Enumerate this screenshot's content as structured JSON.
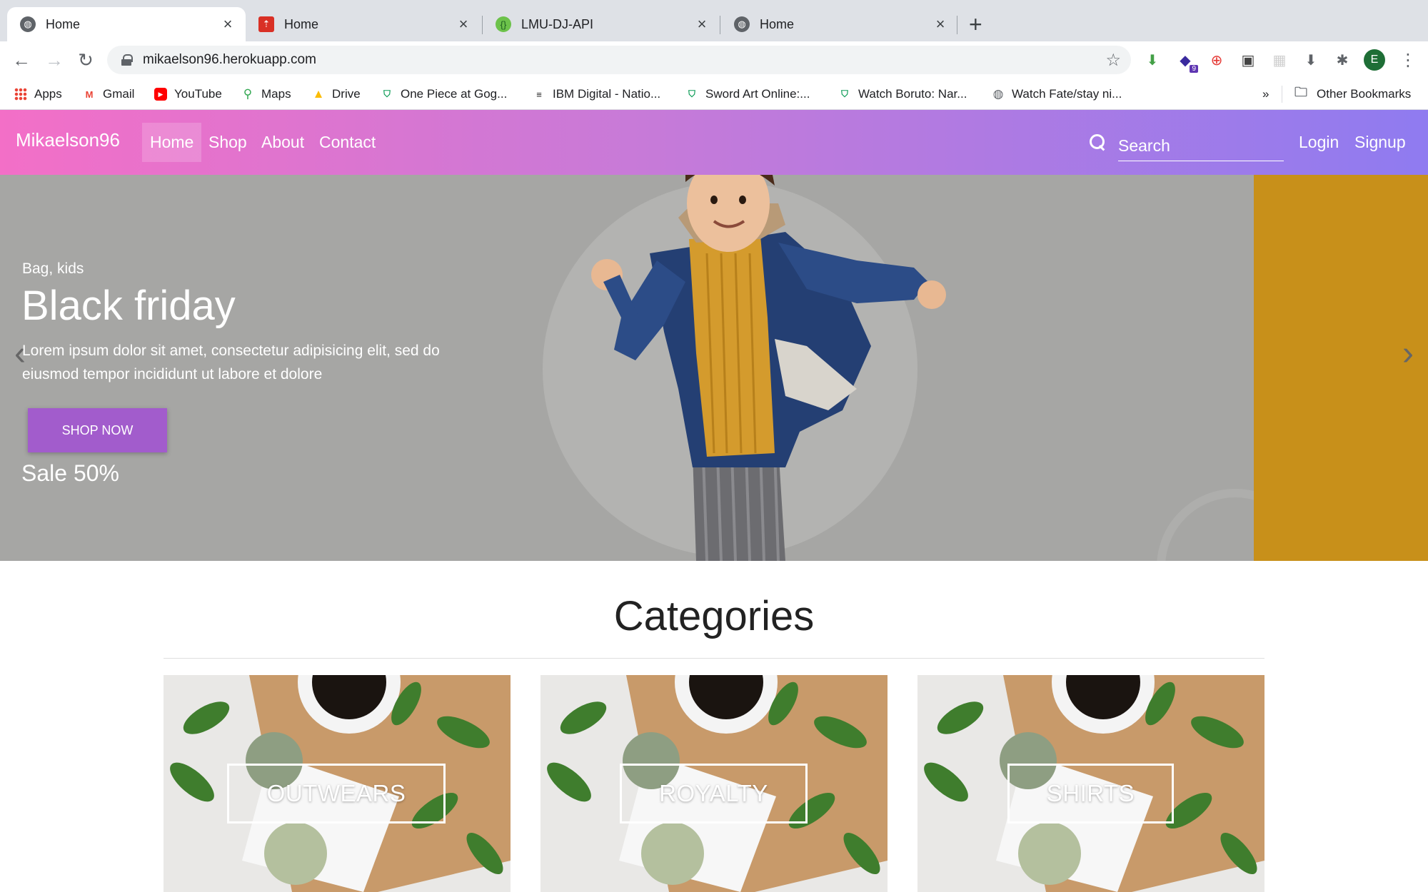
{
  "browser": {
    "tabs": [
      {
        "title": "Home",
        "favicon": "globe-icon",
        "active": true
      },
      {
        "title": "Home",
        "favicon": "red-upload-icon",
        "active": false
      },
      {
        "title": "LMU-DJ-API",
        "favicon": "green-api-icon",
        "active": false
      },
      {
        "title": "Home",
        "favicon": "globe-icon",
        "active": false
      }
    ],
    "url": "mikaelson96.herokuapp.com",
    "profile_initial": "E",
    "extension_badge": "9",
    "bookmarks": [
      {
        "label": "Apps"
      },
      {
        "label": "Gmail"
      },
      {
        "label": "YouTube"
      },
      {
        "label": "Maps"
      },
      {
        "label": "Drive"
      },
      {
        "label": "One Piece at Gog..."
      },
      {
        "label": "IBM Digital - Natio..."
      },
      {
        "label": "Sword Art Online:..."
      },
      {
        "label": "Watch Boruto: Nar..."
      },
      {
        "label": "Watch Fate/stay ni..."
      }
    ],
    "overflow_label": "»",
    "other_bookmarks": "Other Bookmarks"
  },
  "site": {
    "brand": "Mikaelson96",
    "nav": [
      {
        "label": "Home",
        "active": true
      },
      {
        "label": "Shop",
        "active": false
      },
      {
        "label": "About",
        "active": false
      },
      {
        "label": "Contact",
        "active": false
      }
    ],
    "search_placeholder": "Search",
    "login": "Login",
    "signup": "Signup",
    "colors": {
      "gradient_start": "#f36fc7",
      "gradient_end": "#8f7bf0",
      "button": "#a25ccc",
      "hero_side": "#c8901a"
    }
  },
  "hero": {
    "category": "Bag, kids",
    "title": "Black friday",
    "description": "Lorem ipsum dolor sit amet, consectetur adipisicing elit, sed do eiusmod tempor incididunt ut labore et dolore",
    "button": "SHOP NOW",
    "sale": "Sale 50%"
  },
  "categories": {
    "title": "Categories",
    "items": [
      {
        "label": "OUTWEARS"
      },
      {
        "label": "ROYALTY"
      },
      {
        "label": "SHIRTS"
      }
    ]
  }
}
